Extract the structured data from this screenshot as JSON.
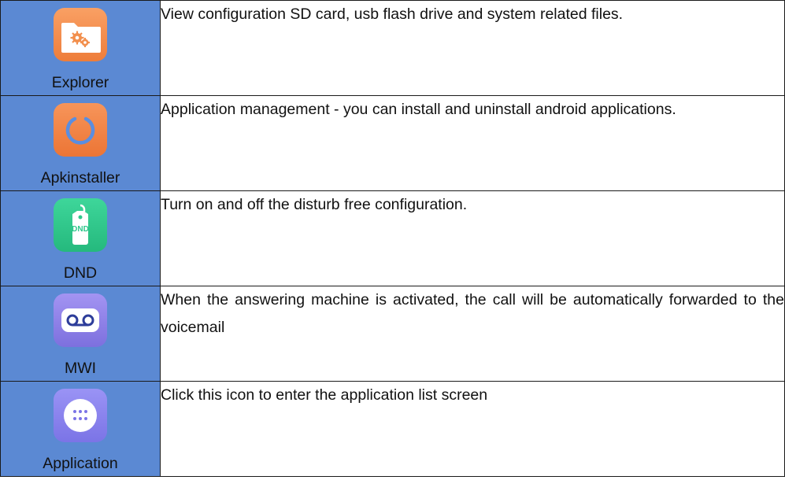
{
  "rows": [
    {
      "label": "Explorer",
      "icon": "folder-gears-icon",
      "icon_color": "#f28f4d",
      "description": "View configuration SD card, usb flash drive and system related files."
    },
    {
      "label": "Apkinstaller",
      "icon": "refresh-ring-icon",
      "icon_color": "#f07d3e",
      "description": "Application management - you can install and uninstall android applications."
    },
    {
      "label": "DND",
      "icon": "dnd-tag-icon",
      "icon_color": "#2fc88c",
      "description": "Turn on and off the disturb free configuration."
    },
    {
      "label": "MWI",
      "icon": "voicemail-icon",
      "icon_color": "#8a7ee6",
      "description": "When the answering machine is activated, the call will be automatically forwarded to the voicemail"
    },
    {
      "label": "Application",
      "icon": "app-grid-icon",
      "icon_color": "#8a85f0",
      "description": "Click this icon to enter the application list screen"
    }
  ],
  "icon_text": {
    "dnd": "DND"
  }
}
